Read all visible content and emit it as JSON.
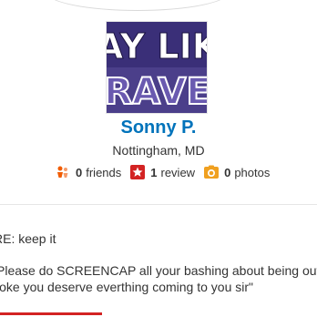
{
  "profile": {
    "avatar_lines": [
      "AY LIK",
      "RAVE"
    ],
    "name": "Sonny P.",
    "location": "Nottingham, MD",
    "friends_count": "0",
    "friends_label": "friends",
    "reviews_count": "1",
    "reviews_label": "review",
    "photos_count": "0",
    "photos_label": "photos"
  },
  "message": {
    "subject": "RE: keep it",
    "body_line1": "Please do SCREENCAP all your bashing about being out",
    "body_line2": "joke you deserve everthing coming to you sir\""
  },
  "colors": {
    "name_link": "#0073bb",
    "accent_red": "#d32323",
    "friends_icon": "#f15c00",
    "avatar_bg": "#5a4a9a"
  },
  "icons": {
    "friends": "friends-icon",
    "review": "review-star-icon",
    "photos": "camera-icon"
  }
}
